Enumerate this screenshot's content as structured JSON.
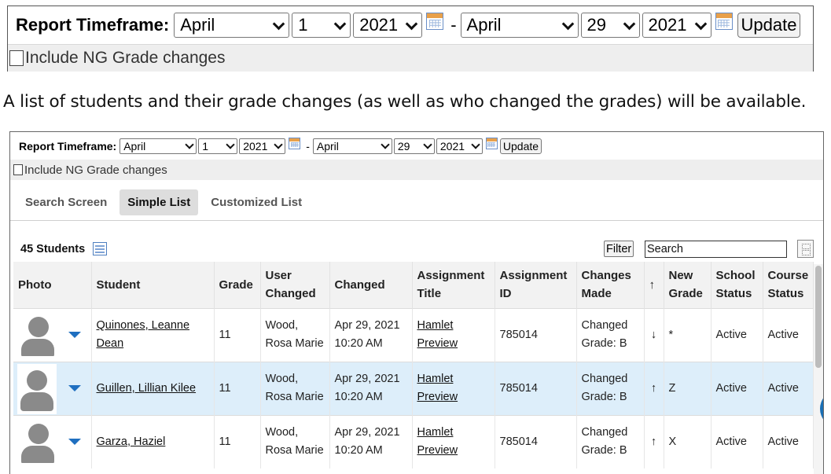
{
  "top_panel": {
    "label": "Report Timeframe:",
    "start_month": "April",
    "start_day": "1",
    "start_year": "2021",
    "dash": "-",
    "end_month": "April",
    "end_day": "29",
    "end_year": "2021",
    "update_label": "Update",
    "include_ng_label": "Include NG Grade changes"
  },
  "caption": "A list of students and their grade changes (as well as who changed the grades) will be available.",
  "app": {
    "label": "Report Timeframe:",
    "start_month": "April",
    "start_day": "1",
    "start_year": "2021",
    "dash": "-",
    "end_month": "April",
    "end_day": "29",
    "end_year": "2021",
    "update_label": "Update",
    "include_ng_label": "Include NG Grade changes",
    "tabs": [
      {
        "label": "Search Screen"
      },
      {
        "label": "Simple List"
      },
      {
        "label": "Customized List"
      }
    ],
    "student_count": "45 Students",
    "filter_label": "Filter",
    "search_placeholder": "Search",
    "columns": {
      "photo": "Photo",
      "student": "Student",
      "grade": "Grade",
      "user_changed": "User Changed",
      "changed": "Changed",
      "assignment_title": "Assignment Title",
      "assignment_id": "Assignment ID",
      "changes_made": "Changes Made",
      "arrow": "↑",
      "new_grade": "New Grade",
      "school_status": "School Status",
      "course_status": "Course Status"
    },
    "rows": [
      {
        "student": "Quinones, Leanne Dean",
        "grade": "11",
        "user_changed": "Wood, Rosa Marie",
        "changed": "Apr 29, 2021 10:20 AM",
        "assignment_title": "Hamlet Preview",
        "assignment_id": "785014",
        "changes_made": "Changed Grade: B",
        "arrow": "↓",
        "new_grade": "*",
        "school_status": "Active",
        "course_status": "Active"
      },
      {
        "student": "Guillen, Lillian Kilee",
        "grade": "11",
        "user_changed": "Wood, Rosa Marie",
        "changed": "Apr 29, 2021 10:20 AM",
        "assignment_title": "Hamlet Preview",
        "assignment_id": "785014",
        "changes_made": "Changed Grade: B",
        "arrow": "↑",
        "new_grade": "Z",
        "school_status": "Active",
        "course_status": "Active"
      },
      {
        "student": "Garza, Haziel",
        "grade": "11",
        "user_changed": "Wood, Rosa Marie",
        "changed": "Apr 29, 2021 10:20 AM",
        "assignment_title": "Hamlet Preview",
        "assignment_id": "785014",
        "changes_made": "Changed Grade: B",
        "arrow": "↑",
        "new_grade": "X",
        "school_status": "Active",
        "course_status": "Active"
      }
    ]
  },
  "colors": {
    "accent_blue": "#1f6fc0",
    "status_green": "#2c8a2c",
    "selected_row": "#ddeefa"
  },
  "icons": [
    "calendar-icon",
    "chevron-down-icon",
    "export-icon",
    "collapse-icon",
    "avatar-placeholder",
    "row-dropdown-caret"
  ]
}
